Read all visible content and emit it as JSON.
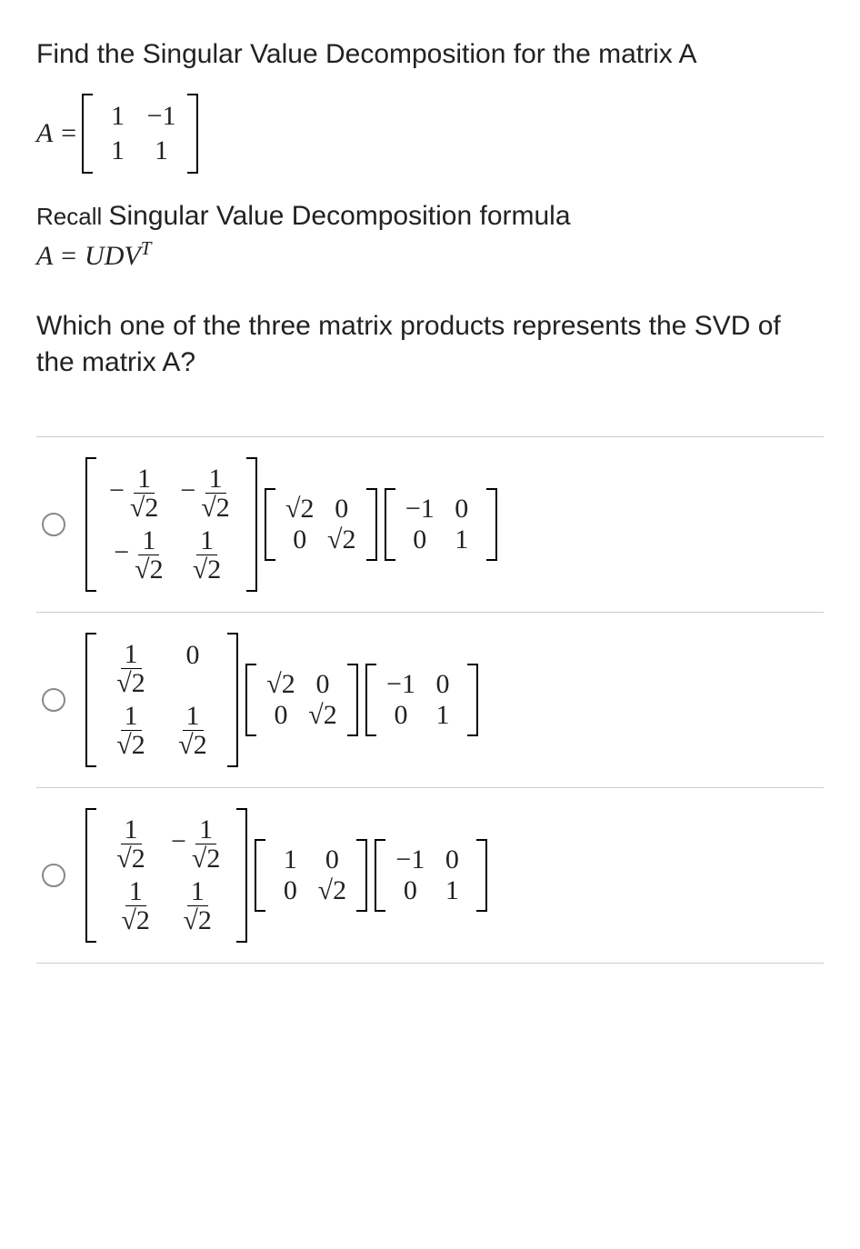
{
  "prompt": {
    "line1": "Find the Singular Value Decomposition for the matrix A",
    "A_label": "A =",
    "A_rows": [
      [
        "1",
        "−1"
      ],
      [
        "1",
        "1"
      ]
    ],
    "recall_small": "Recall ",
    "recall_big": "Singular Value Decomposition formula",
    "formula": "A = UDVᵀ",
    "question": "Which one of the three matrix products represents the SVD of the matrix  A?"
  },
  "sqrt2": "√2",
  "options": [
    {
      "U": [
        [
          "−1/√2",
          "−1/√2"
        ],
        [
          "−1/√2",
          "1/√2"
        ]
      ],
      "D": [
        [
          "√2",
          "0"
        ],
        [
          "0",
          "√2"
        ]
      ],
      "Vt": [
        [
          "−1",
          "0"
        ],
        [
          "0",
          "1"
        ]
      ]
    },
    {
      "U": [
        [
          "1/√2",
          "0"
        ],
        [
          "1/√2",
          "1/√2"
        ]
      ],
      "D": [
        [
          "√2",
          "0"
        ],
        [
          "0",
          "√2"
        ]
      ],
      "Vt": [
        [
          "−1",
          "0"
        ],
        [
          "0",
          "1"
        ]
      ]
    },
    {
      "U": [
        [
          "1/√2",
          "−1/√2"
        ],
        [
          "1/√2",
          "1/√2"
        ]
      ],
      "D": [
        [
          "1",
          "0"
        ],
        [
          "0",
          "√2"
        ]
      ],
      "Vt": [
        [
          "−1",
          "0"
        ],
        [
          "0",
          "1"
        ]
      ]
    }
  ]
}
